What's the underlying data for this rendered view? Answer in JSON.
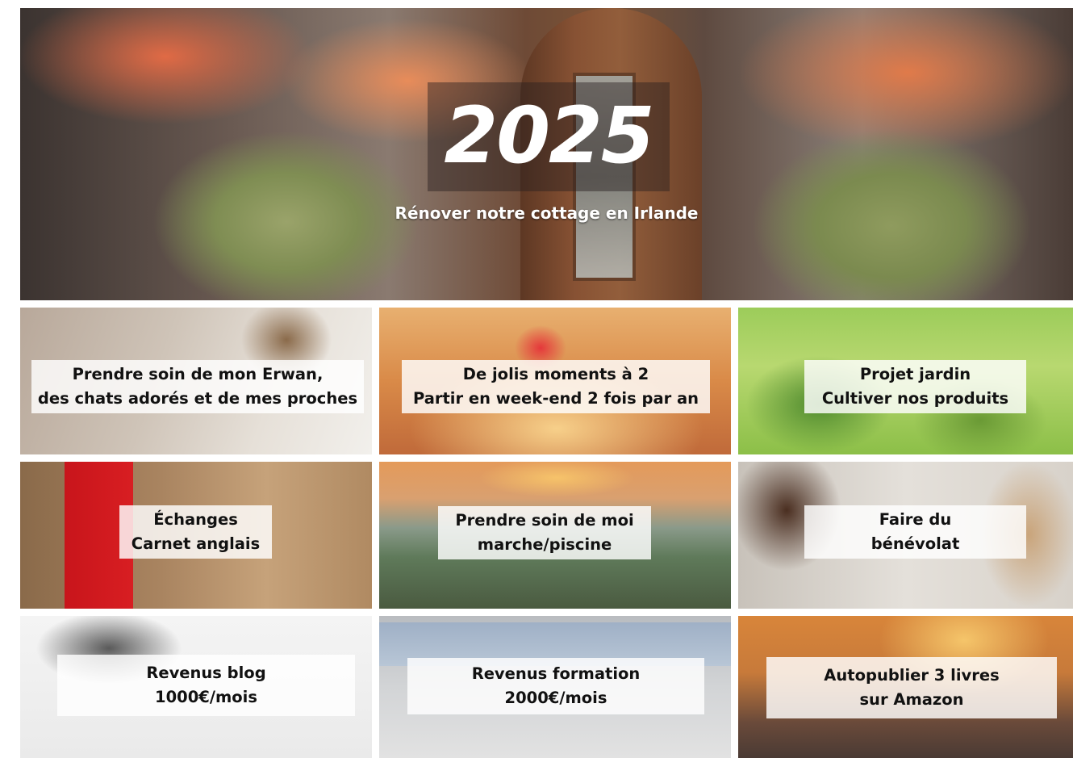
{
  "hero": {
    "title": "2025",
    "subtitle": "Rénover notre cottage en Irlande"
  },
  "tiles": [
    {
      "line1": "Prendre soin de mon Erwan,",
      "line2": "des chats adorés et de mes proches"
    },
    {
      "line1": "De jolis moments à 2",
      "line2": "Partir en week-end 2 fois par an"
    },
    {
      "line1": "Projet jardin",
      "line2": "Cultiver nos produits"
    },
    {
      "line1": "Échanges",
      "line2": "Carnet anglais"
    },
    {
      "line1": "Prendre soin de moi",
      "line2": "marche/piscine"
    },
    {
      "line1": "Faire du",
      "line2": "bénévolat"
    },
    {
      "line1": "Revenus blog",
      "line2": "1000€/mois"
    },
    {
      "line1": "Revenus formation",
      "line2": "2000€/mois"
    },
    {
      "line1": "Autopublier 3 livres",
      "line2": "sur Amazon"
    }
  ]
}
